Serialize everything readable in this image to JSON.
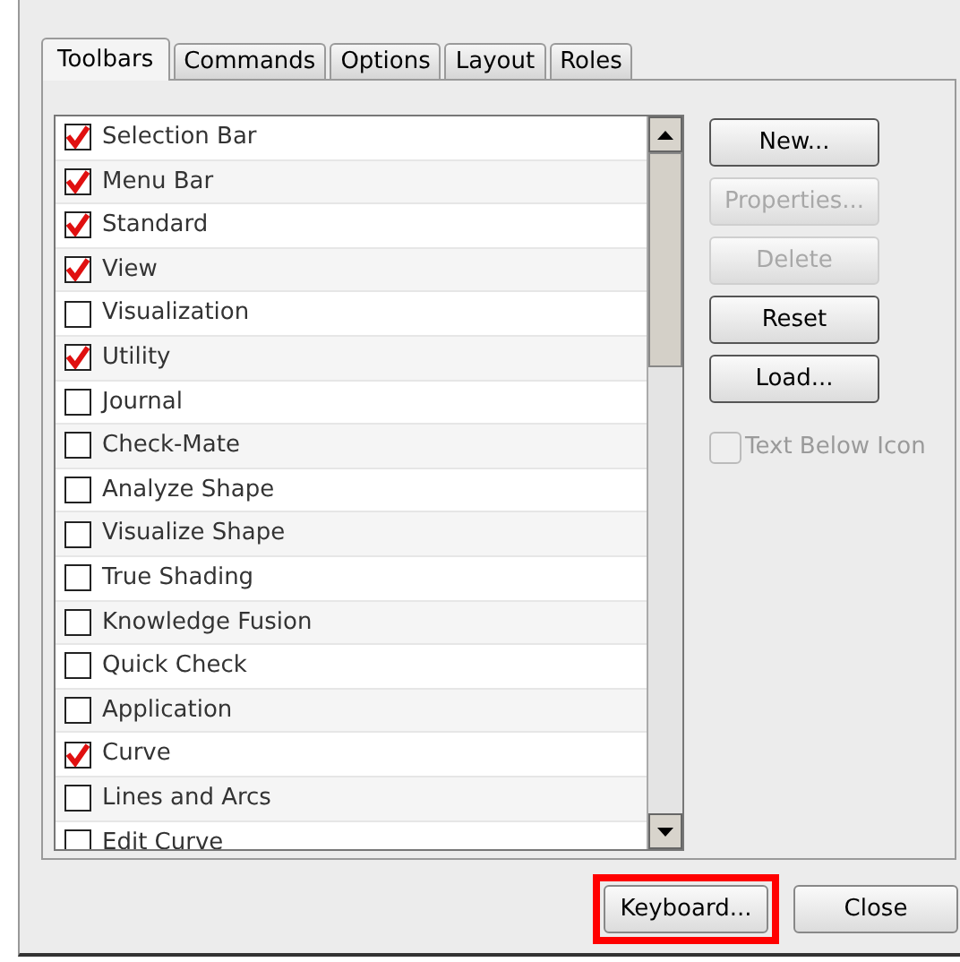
{
  "tabs": [
    {
      "label": "Toolbars",
      "selected": true
    },
    {
      "label": "Commands",
      "selected": false
    },
    {
      "label": "Options",
      "selected": false
    },
    {
      "label": "Layout",
      "selected": false
    },
    {
      "label": "Roles",
      "selected": false
    }
  ],
  "toolbars": [
    {
      "label": "Selection Bar",
      "checked": true
    },
    {
      "label": "Menu Bar",
      "checked": true
    },
    {
      "label": "Standard",
      "checked": true
    },
    {
      "label": "View",
      "checked": true
    },
    {
      "label": "Visualization",
      "checked": false
    },
    {
      "label": "Utility",
      "checked": true
    },
    {
      "label": "Journal",
      "checked": false
    },
    {
      "label": "Check-Mate",
      "checked": false
    },
    {
      "label": "Analyze Shape",
      "checked": false
    },
    {
      "label": "Visualize Shape",
      "checked": false
    },
    {
      "label": "True Shading",
      "checked": false
    },
    {
      "label": "Knowledge Fusion",
      "checked": false
    },
    {
      "label": "Quick Check",
      "checked": false
    },
    {
      "label": "Application",
      "checked": false
    },
    {
      "label": "Curve",
      "checked": true
    },
    {
      "label": "Lines and Arcs",
      "checked": false
    },
    {
      "label": "Edit Curve",
      "checked": false
    }
  ],
  "side_buttons": [
    {
      "label": "New...",
      "disabled": false
    },
    {
      "label": "Properties...",
      "disabled": true
    },
    {
      "label": "Delete",
      "disabled": true
    },
    {
      "label": "Reset",
      "disabled": false
    },
    {
      "label": "Load...",
      "disabled": false
    }
  ],
  "text_below_icon": {
    "label": "Text Below Icon",
    "checked": false,
    "disabled": true
  },
  "footer_buttons": [
    {
      "label": "Keyboard...",
      "highlighted": true
    },
    {
      "label": "Close",
      "highlighted": false
    }
  ]
}
